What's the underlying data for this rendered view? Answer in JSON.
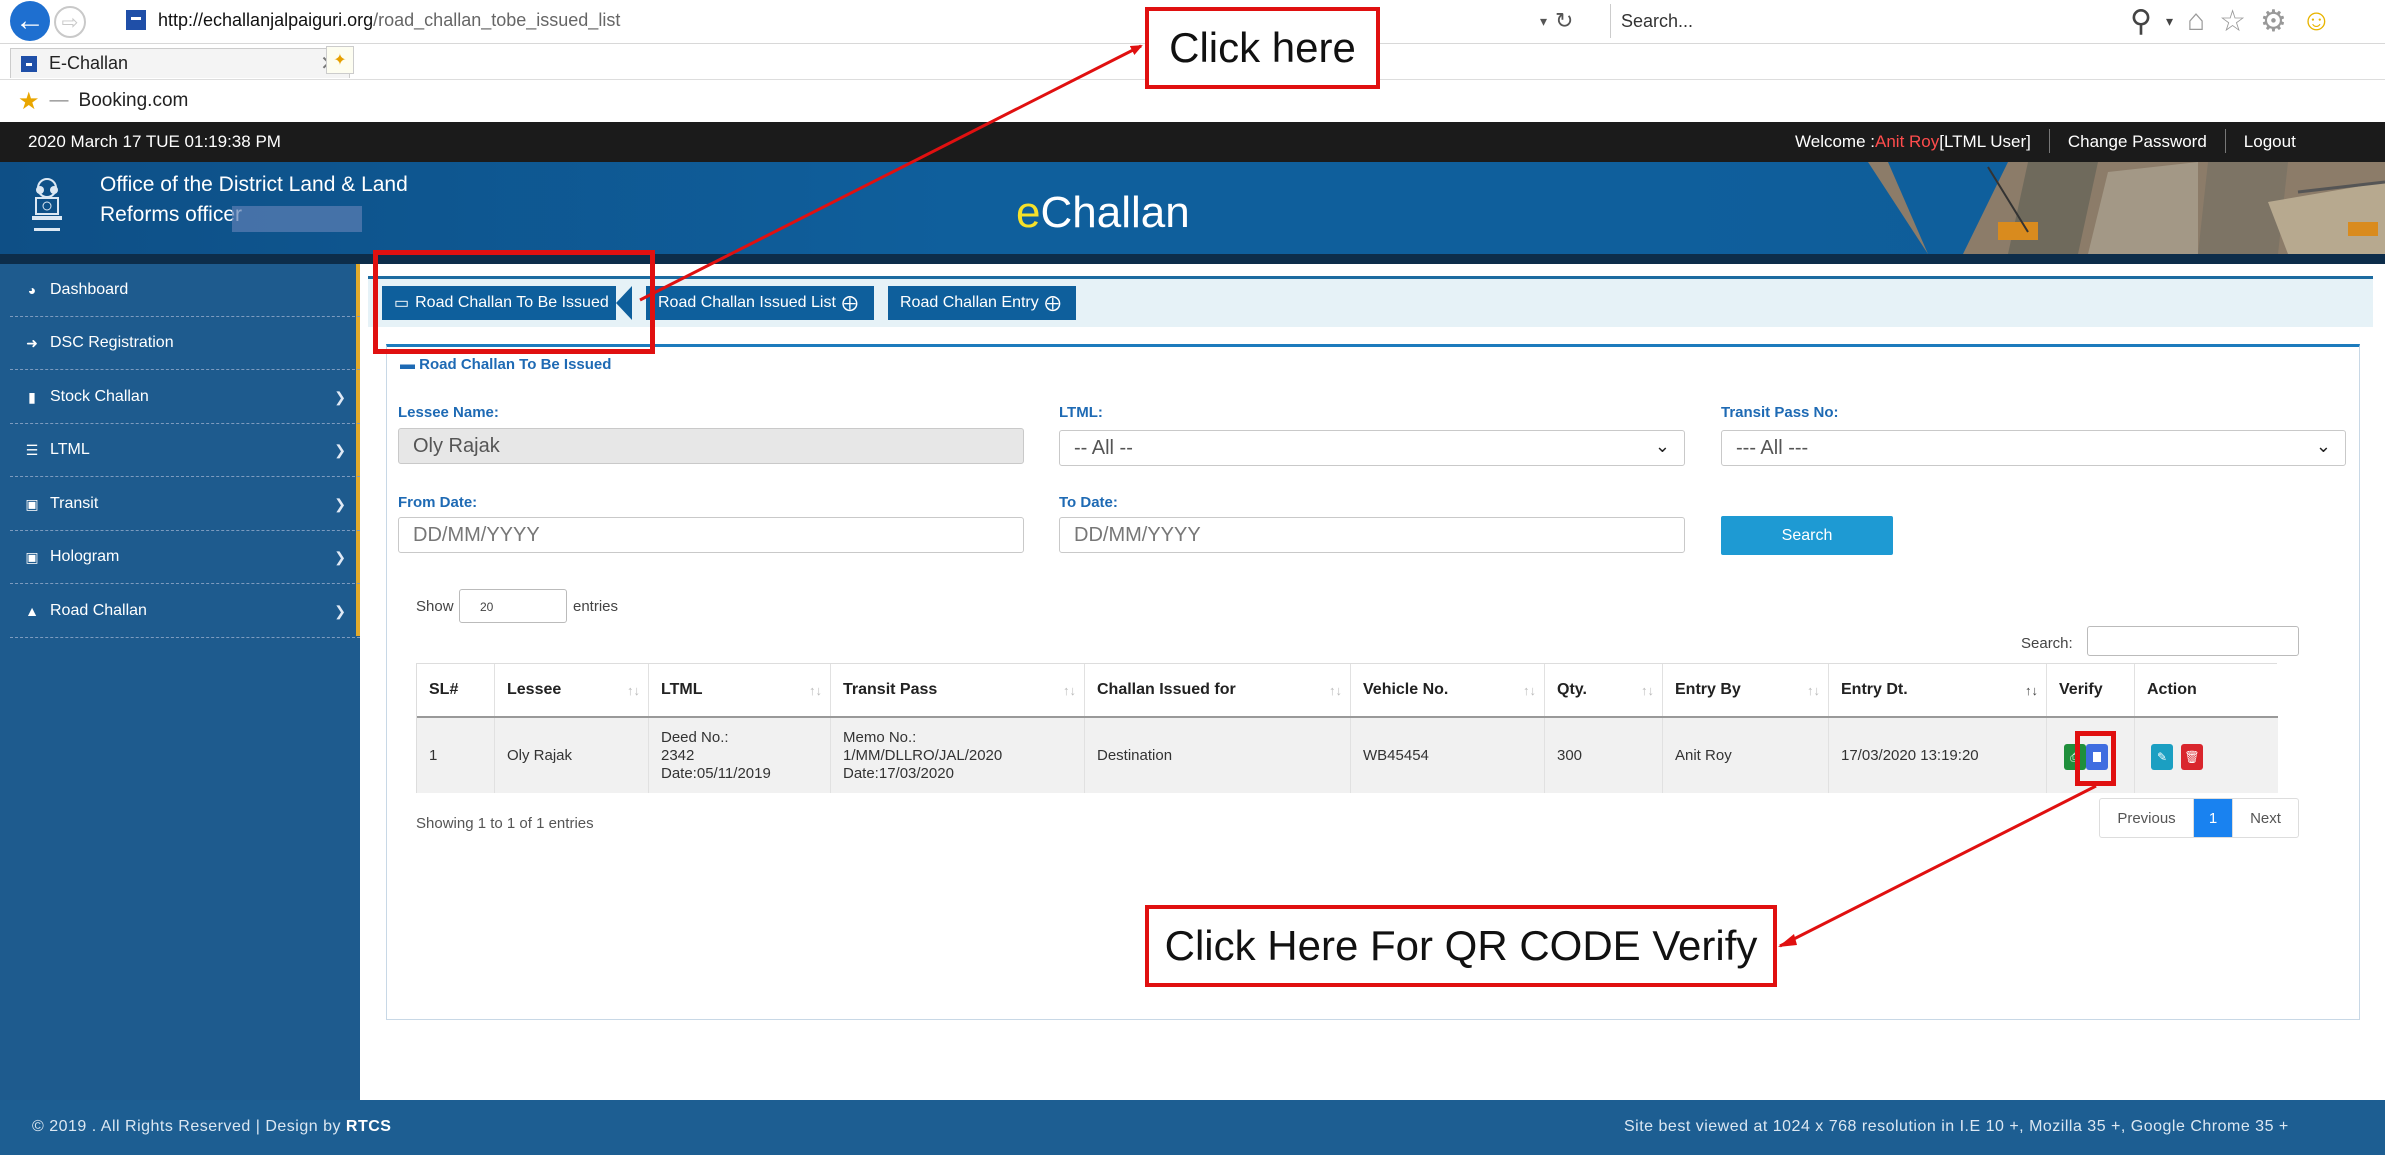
{
  "browser": {
    "url_domain": "http://echallanjalpaiguri.org",
    "url_path": "/road_challan_tobe_issued_list",
    "search_placeholder": "Search...",
    "tab_title": "E-Challan",
    "favorite": "Booking.com"
  },
  "topbar": {
    "datetime": "2020 March 17 TUE  01:19:38 PM",
    "welcome_label": "Welcome : ",
    "user_name": "Anit Roy",
    "user_role": " [LTML User]",
    "change_password": "Change Password",
    "logout": "Logout"
  },
  "header": {
    "office_line1": "Office of the District Land & Land",
    "office_line2": "Reforms officer",
    "logo_e": "e",
    "logo_rest": "Challan"
  },
  "sidebar": {
    "items": [
      {
        "label": "Dashboard",
        "icon": "dashboard-icon",
        "has_submenu": false
      },
      {
        "label": "DSC Registration",
        "icon": "sign-in-icon",
        "has_submenu": false
      },
      {
        "label": "Stock Challan",
        "icon": "book-icon",
        "has_submenu": true
      },
      {
        "label": "LTML",
        "icon": "list-icon",
        "has_submenu": true
      },
      {
        "label": "Transit",
        "icon": "card-icon",
        "has_submenu": true
      },
      {
        "label": "Hologram",
        "icon": "h-square-icon",
        "has_submenu": true
      },
      {
        "label": "Road Challan",
        "icon": "road-icon",
        "has_submenu": true
      }
    ]
  },
  "tabs": {
    "active": "Road Challan To Be Issued",
    "issued_list": "Road Challan Issued List",
    "entry": "Road Challan Entry"
  },
  "panel": {
    "title": "Road Challan To Be Issued",
    "lessee_label": "Lessee Name:",
    "lessee_value": "Oly Rajak",
    "ltml_label": "LTML:",
    "ltml_value": "-- All --",
    "transit_label": "Transit Pass No:",
    "transit_value": "--- All ---",
    "from_label": "From Date:",
    "from_placeholder": "DD/MM/YYYY",
    "to_label": "To Date:",
    "to_placeholder": "DD/MM/YYYY",
    "search_button": "Search",
    "show_label": "Show",
    "show_value": "20",
    "entries_label": "entries",
    "table_search_label": "Search:"
  },
  "table": {
    "headers": [
      "SL#",
      "Lessee",
      "LTML",
      "Transit Pass",
      "Challan Issued for",
      "Vehicle No.",
      "Qty.",
      "Entry By",
      "Entry Dt.",
      "Verify",
      "Action"
    ],
    "rows": [
      {
        "sl": "1",
        "lessee": "Oly Rajak",
        "ltml_line1": "Deed No.:",
        "ltml_line2": "2342",
        "ltml_line3": "Date:05/11/2019",
        "transit_line1": "Memo No.:",
        "transit_line2": "1/MM/DLLRO/JAL/2020",
        "transit_line3": "Date:17/03/2020",
        "issued_for": "Destination",
        "vehicle": "WB45454",
        "qty": "300",
        "entry_by": "Anit Roy",
        "entry_dt": "17/03/2020 13:19:20"
      }
    ],
    "showing": "Showing 1 to 1 of 1 entries",
    "pager_prev": "Previous",
    "pager_current": "1",
    "pager_next": "Next"
  },
  "footer": {
    "copyright_prefix": "© 2019 . All Rights Reserved | Design by ",
    "copyright_brand": "RTCS",
    "best_viewed": "Site best viewed at 1024 x 768 resolution in I.E 10 +, Mozilla 35 +, Google Chrome 35 +"
  },
  "annotations": {
    "click_here": "Click here",
    "qr_verify": "Click Here For QR CODE Verify"
  },
  "colors": {
    "annotation_red": "#e01010",
    "header_blue": "#0f5f9c",
    "sidebar_blue": "#1e5b8e",
    "logo_yellow": "#f6e12a",
    "print_green": "#1f8f3c",
    "qr_blue": "#3f6de0",
    "edit_teal": "#1b9fc2",
    "delete_red": "#d9262d"
  }
}
